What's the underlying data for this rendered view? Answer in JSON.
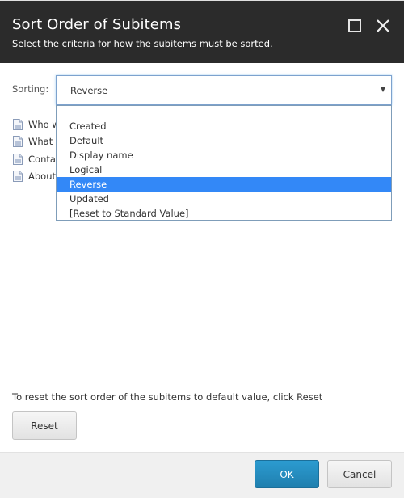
{
  "dialog": {
    "title": "Sort Order of Subitems",
    "subtitle": "Select the criteria for how the subitems must be sorted.",
    "maximize_icon": "square-icon",
    "close_icon": "x-icon"
  },
  "sorting": {
    "label": "Sorting:",
    "selected": "Reverse",
    "options": [
      "Created",
      "Default",
      "Display name",
      "Logical",
      "Reverse",
      "Updated",
      "[Reset to Standard Value]"
    ],
    "highlight_color": "#3388f7"
  },
  "subitems": [
    {
      "label": "Who we are",
      "icon": "document-icon"
    },
    {
      "label": "What we do",
      "icon": "document-icon"
    },
    {
      "label": "Contact",
      "icon": "document-icon"
    },
    {
      "label": "About",
      "icon": "document-icon"
    }
  ],
  "reset": {
    "text": "To reset the sort order of the subitems to default value, click Reset",
    "button_label": "Reset"
  },
  "footer": {
    "ok_label": "OK",
    "cancel_label": "Cancel",
    "ok_color": "#2389bf"
  }
}
